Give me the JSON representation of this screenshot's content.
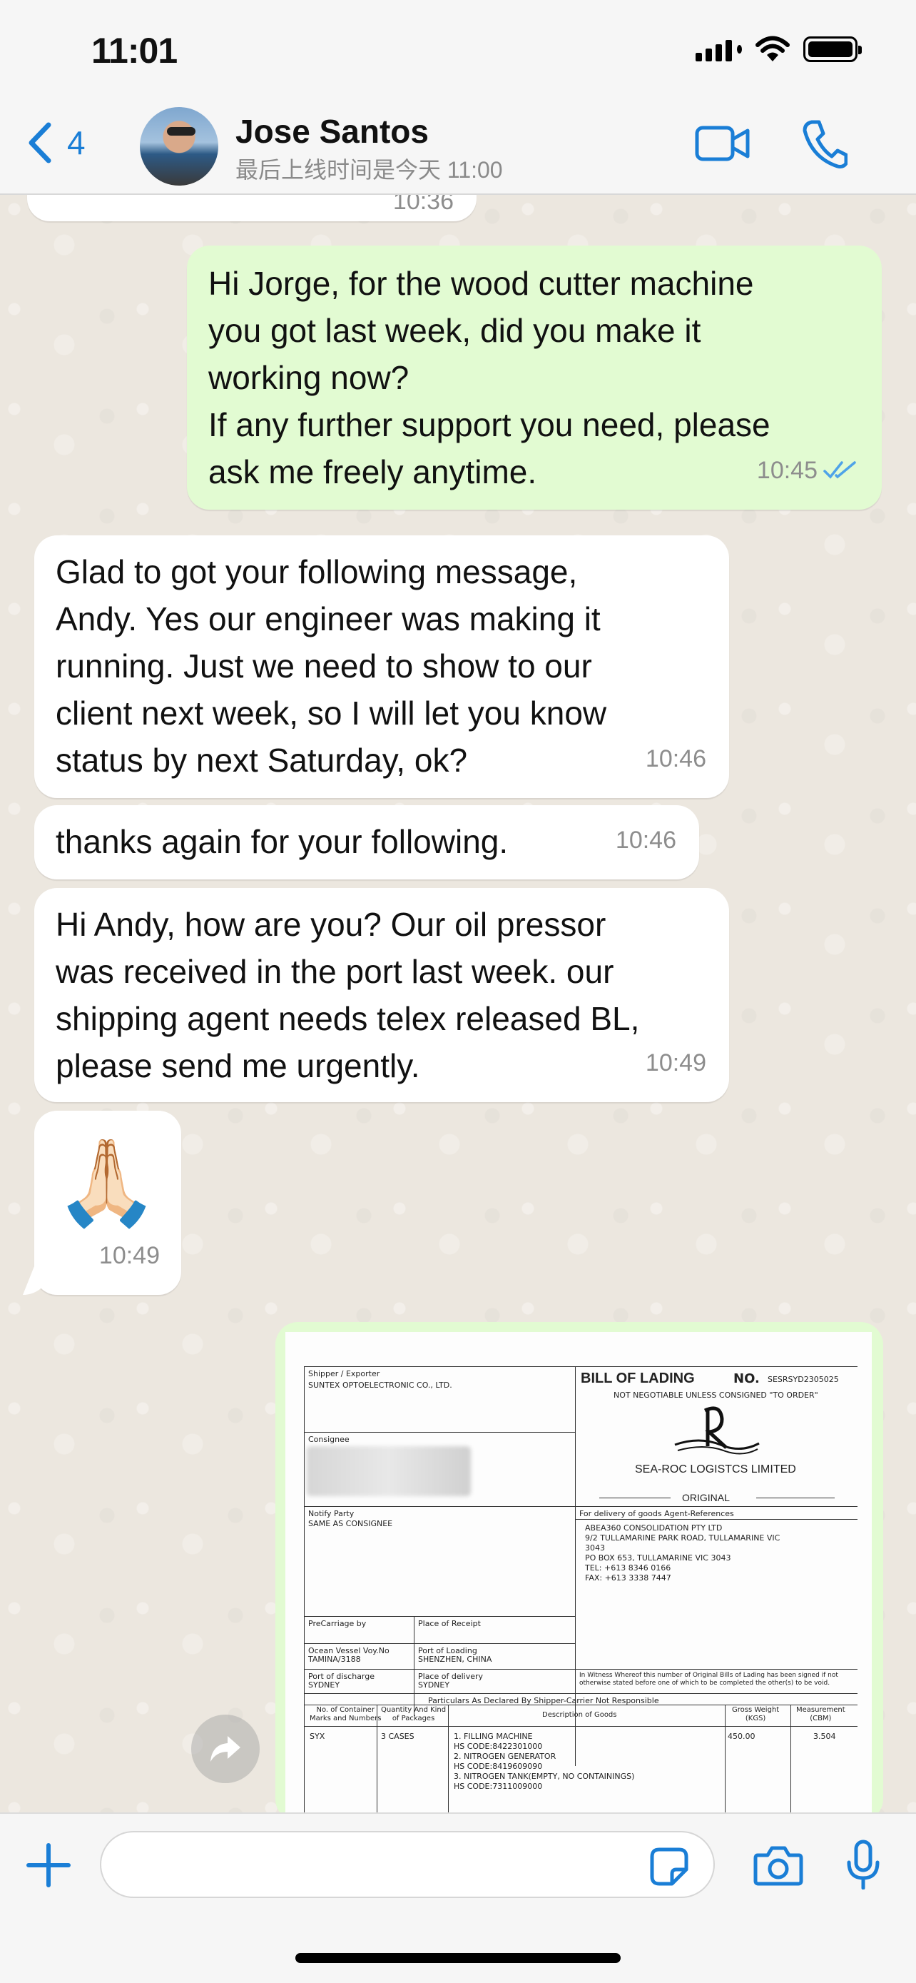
{
  "status_bar": {
    "time": "11:01"
  },
  "header": {
    "back_count": "4",
    "contact_name": "Jose Santos",
    "contact_status": "最后上线时间是今天 11:00"
  },
  "messages": [
    {
      "direction": "in",
      "time": "10:36",
      "text": "",
      "partial": true
    },
    {
      "direction": "out",
      "time": "10:45",
      "read": true,
      "text": "Hi Jorge, for the wood cutter machine\nyou got last week, did you make it\nworking now?\nIf any further support you need, please\nask me freely anytime."
    },
    {
      "direction": "in",
      "time": "10:46",
      "text": "Glad to got your following message,\nAndy. Yes our engineer was making it\nrunning. Just we need to show to our\nclient next week, so I will let you know\nstatus by next Saturday, ok?"
    },
    {
      "direction": "in",
      "time": "10:46",
      "text": "thanks again for your following."
    },
    {
      "direction": "in",
      "time": "10:49",
      "text": "Hi Andy, how are you? Our oil pressor\nwas received in the port last week. our\nshipping agent needs telex released BL,\nplease send me urgently."
    },
    {
      "direction": "in",
      "time": "10:49",
      "text": "🙏🏻"
    }
  ],
  "document": {
    "shipper_label": "Shipper / Exporter",
    "shipper_value": "SUNTEX OPTOELECTRONIC CO., LTD.",
    "title": "BILL OF LADING",
    "no_label": "NO.",
    "no_value": "SESRSYD2305025",
    "not_negotiable": "NOT NEGOTIABLE UNLESS CONSIGNED \"TO ORDER\"",
    "company": "SEA-ROC LOGISTCS LIMITED",
    "original": "ORIGINAL",
    "consignee_label": "Consignee",
    "notify_label": "Notify Party",
    "notify_value": "SAME AS CONSIGNEE",
    "delivery_agent_label": "For delivery of goods Agent-References",
    "agent_lines": [
      "ABEA360 CONSOLIDATION PTY LTD",
      "9/2 TULLAMARINE PARK ROAD, TULLAMARINE VIC",
      "3043",
      "PO BOX 653, TULLAMARINE VIC 3043",
      "TEL: +613 8346 0166",
      "FAX: +613 3338 7447"
    ],
    "precarriage_label": "PreCarriage by",
    "place_receipt_label": "Place of Receipt",
    "vessel_label": "Ocean Vessel Voy.No",
    "vessel_value": "TAMINA/3188",
    "port_loading_label": "Port of Loading",
    "port_loading_value": "SHENZHEN, CHINA",
    "port_discharge_label": "Port of discharge",
    "port_discharge_value": "SYDNEY",
    "place_delivery_label": "Place of delivery",
    "place_delivery_value": "SYDNEY",
    "witness_text": "In Witness Whereof this number of Original Bills of Lading has been signed if not otherwise stated before one of which to be completed the other(s) to be void.",
    "particulars": "Particulars As Declared By Shipper-Carrier Not Responsible",
    "col_marks": "No. of Container\nMarks and Numbers",
    "col_qty": "Quantity And Kind\nof Packages",
    "col_desc": "Description of Goods",
    "col_weight": "Gross Weight\n(KGS)",
    "col_measure": "Measurement\n(CBM)",
    "row_marks": "SYX",
    "row_qty": "3 CASES",
    "row_desc": "1. FILLING MACHINE\nHS CODE:8422301000\n2. NITROGEN GENERATOR\nHS CODE:8419609090\n3. NITROGEN TANK(EMPTY, NO CONTAININGS)\nHS CODE:7311009000",
    "row_weight": "450.00",
    "row_measure": "3.504"
  },
  "input": {
    "placeholder": ""
  },
  "colors": {
    "accent": "#1a7ed6",
    "outgoing_bubble": "#e2fbd2",
    "read_tick": "#4fa3e8"
  }
}
